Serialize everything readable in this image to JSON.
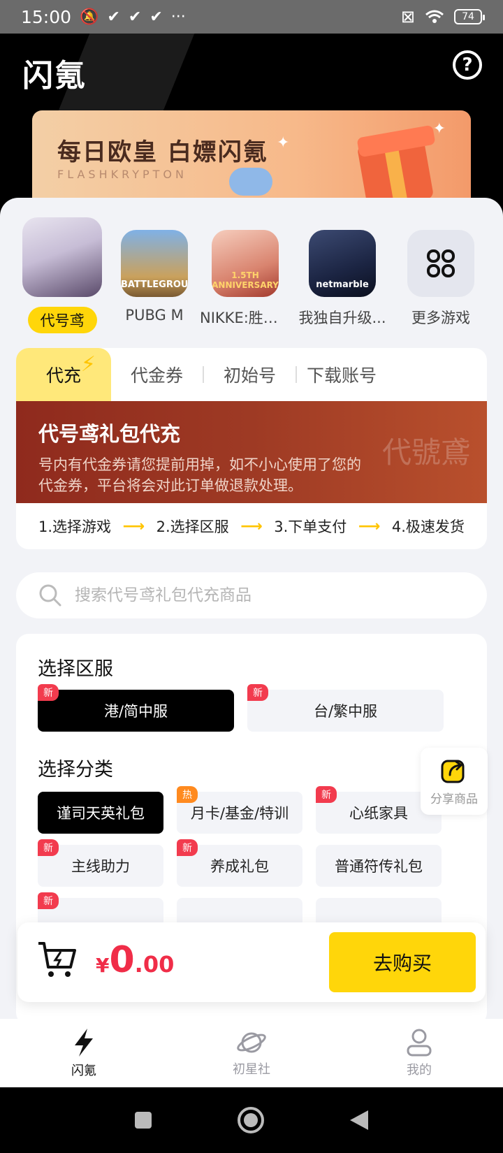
{
  "status_bar": {
    "time": "15:00",
    "battery": "74"
  },
  "header": {
    "logo": "闪氪"
  },
  "banner": {
    "title": "每日欧皇 白嫖闪氪",
    "subtitle": "FLASHKRYPTON"
  },
  "games": [
    {
      "name": "代号鸢",
      "active": true
    },
    {
      "name": "PUBG M",
      "icon_text": "BATTLEGROUNDS"
    },
    {
      "name": "NIKKE:胜利...",
      "icon_text": "1.5TH ANNIVERSARY"
    },
    {
      "name": "我独自升级...",
      "icon_text": "netmarble"
    },
    {
      "name": "更多游戏"
    }
  ],
  "tabs": [
    "代充",
    "代金券",
    "初始号",
    "下载账号"
  ],
  "promo": {
    "title": "代号鸢礼包代充",
    "desc": "号内有代金券请您提前用掉，如不小心使用了您的代金券，平台将会对此订单做退款处理。",
    "watermark": "代號鳶"
  },
  "steps": [
    "1.选择游戏",
    "2.选择区服",
    "3.下单支付",
    "4.极速发货"
  ],
  "search": {
    "placeholder": "搜索代号鸢礼包代充商品"
  },
  "server_section": {
    "title": "选择区服",
    "options": [
      {
        "label": "港/简中服",
        "badge": "新",
        "selected": true
      },
      {
        "label": "台/繁中服",
        "badge": "新"
      }
    ]
  },
  "category_section": {
    "title": "选择分类",
    "options": [
      {
        "label": "谨司天英礼包",
        "selected": true
      },
      {
        "label": "月卡/基金/特训",
        "badge": "热"
      },
      {
        "label": "心纸家具",
        "badge": "新"
      },
      {
        "label": "主线助力",
        "badge": "新"
      },
      {
        "label": "养成礼包",
        "badge": "新"
      },
      {
        "label": "普通符传礼包"
      },
      {
        "label": "",
        "badge": "新"
      }
    ]
  },
  "share": {
    "label": "分享商品"
  },
  "cart": {
    "currency": "¥",
    "price_int": "0",
    "price_dec": ".00",
    "buy_label": "去购买"
  },
  "tabbar": [
    {
      "label": "闪氪",
      "active": true
    },
    {
      "label": "初星社"
    },
    {
      "label": "我的"
    }
  ],
  "colors": {
    "accent": "#ffd60a",
    "price": "#f02d48",
    "promo": "#9e3a24"
  }
}
